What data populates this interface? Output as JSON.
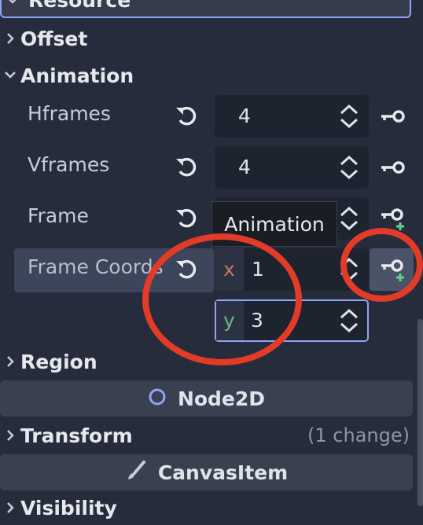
{
  "sections": {
    "resource": "Resource",
    "offset": "Offset",
    "animation": "Animation",
    "region": "Region",
    "transform": "Transform",
    "transform_changes": "(1 change)",
    "visibility": "Visibility"
  },
  "properties": {
    "hframes": {
      "label": "Hframes",
      "value": "4"
    },
    "vframes": {
      "label": "Vframes",
      "value": "4"
    },
    "frame": {
      "label": "Frame",
      "value": ""
    },
    "frame_coords": {
      "label": "Frame Coords",
      "x_label": "x",
      "x_value": "1",
      "y_label": "y",
      "y_value": "3"
    }
  },
  "tooltip": "Animation",
  "categories": {
    "node2d": "Node2D",
    "canvas_item": "CanvasItem"
  },
  "colors": {
    "background": "#262c3b",
    "field": "#1e2330",
    "selected_row": "#3c4559",
    "accent": "#8da5f3",
    "annotation": "#e23b27",
    "key_add": "#5fd38d"
  },
  "icons": {
    "revert": "revert-icon",
    "key": "key-icon",
    "key_add": "key-add-icon",
    "spinner": "spinner-arrows-icon",
    "node2d": "node2d-circle-icon",
    "canvas_item": "brush-icon"
  }
}
